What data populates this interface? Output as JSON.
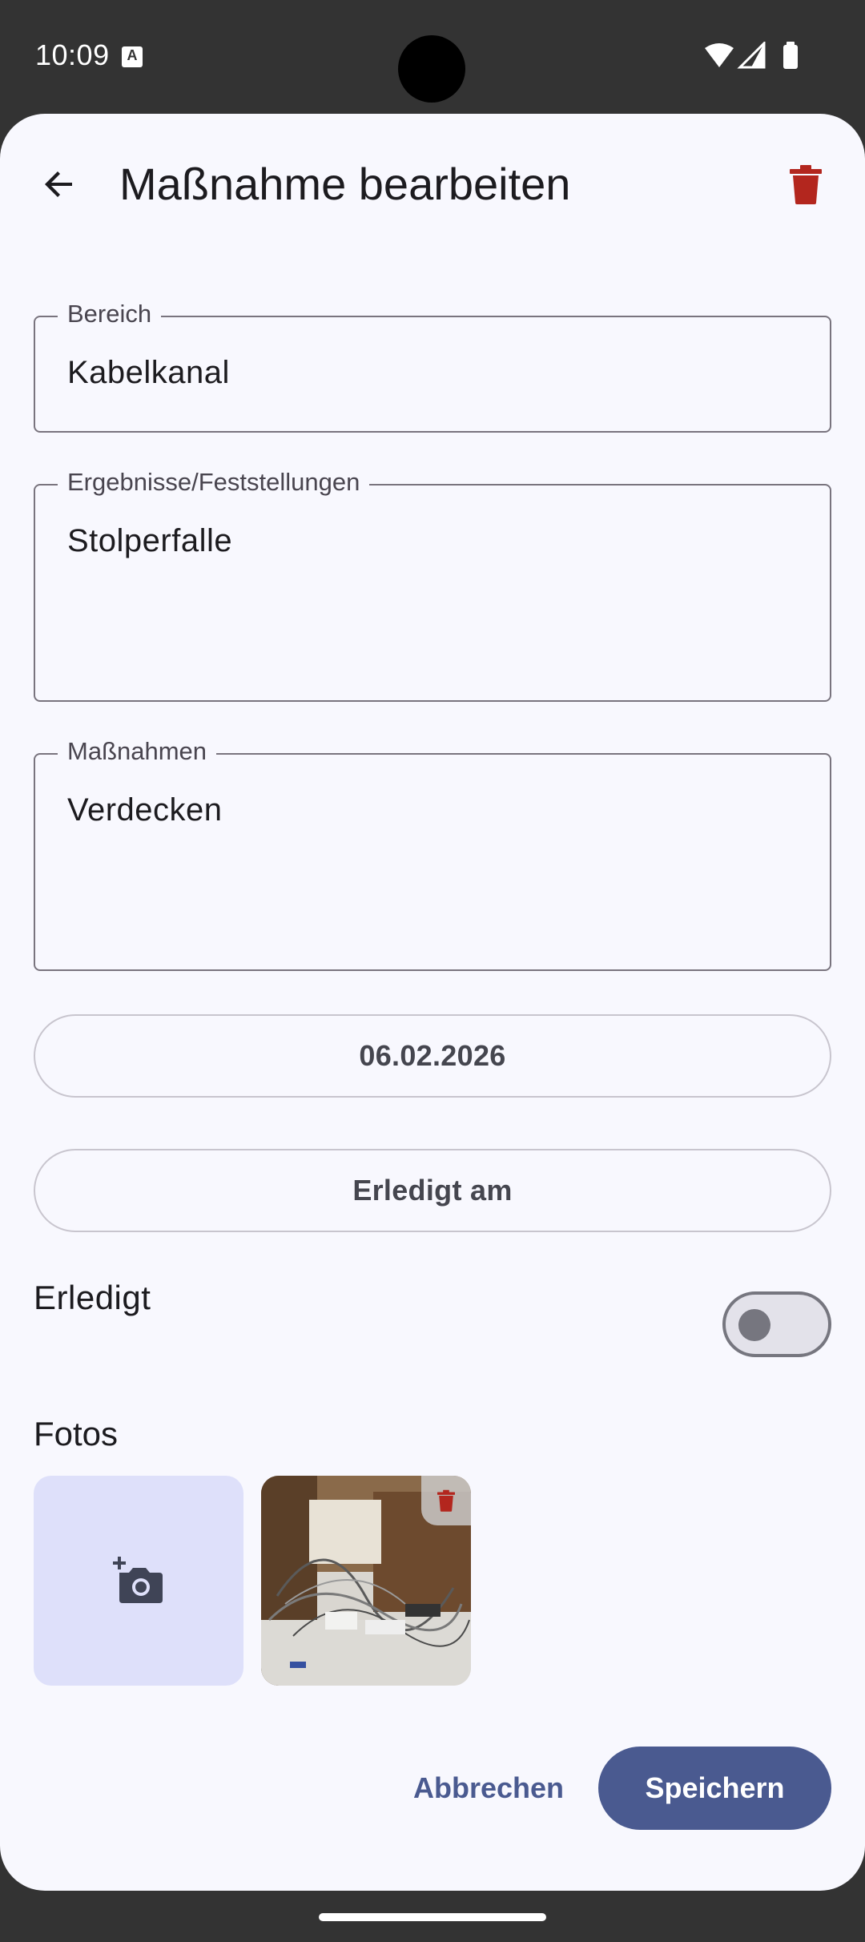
{
  "status_bar": {
    "time": "10:09",
    "icons": [
      "text-notification-icon",
      "wifi-icon",
      "signal-icon",
      "battery-icon"
    ]
  },
  "topbar": {
    "title": "Maßnahme bearbeiten",
    "back_icon": "arrow-back-icon",
    "delete_icon": "trash-icon"
  },
  "form": {
    "bereich": {
      "label": "Bereich",
      "value": "Kabelkanal"
    },
    "ergebnisse": {
      "label": "Ergebnisse/Feststellungen",
      "value": "Stolperfalle"
    },
    "massnahmen": {
      "label": "Maßnahmen",
      "value": "Verdecken"
    },
    "date_button": "06.02.2026",
    "done_date_button": "Erledigt am",
    "done_label": "Erledigt",
    "done_checked": false
  },
  "photos": {
    "title": "Fotos",
    "add_icon": "add-photo-camera-icon",
    "count": 1
  },
  "actions": {
    "cancel": "Abbrechen",
    "save": "Speichern"
  },
  "colors": {
    "primary": "#4a5a90",
    "danger": "#b3261e",
    "surface": "#f8f8fe",
    "add_tile": "#dee0fa"
  }
}
